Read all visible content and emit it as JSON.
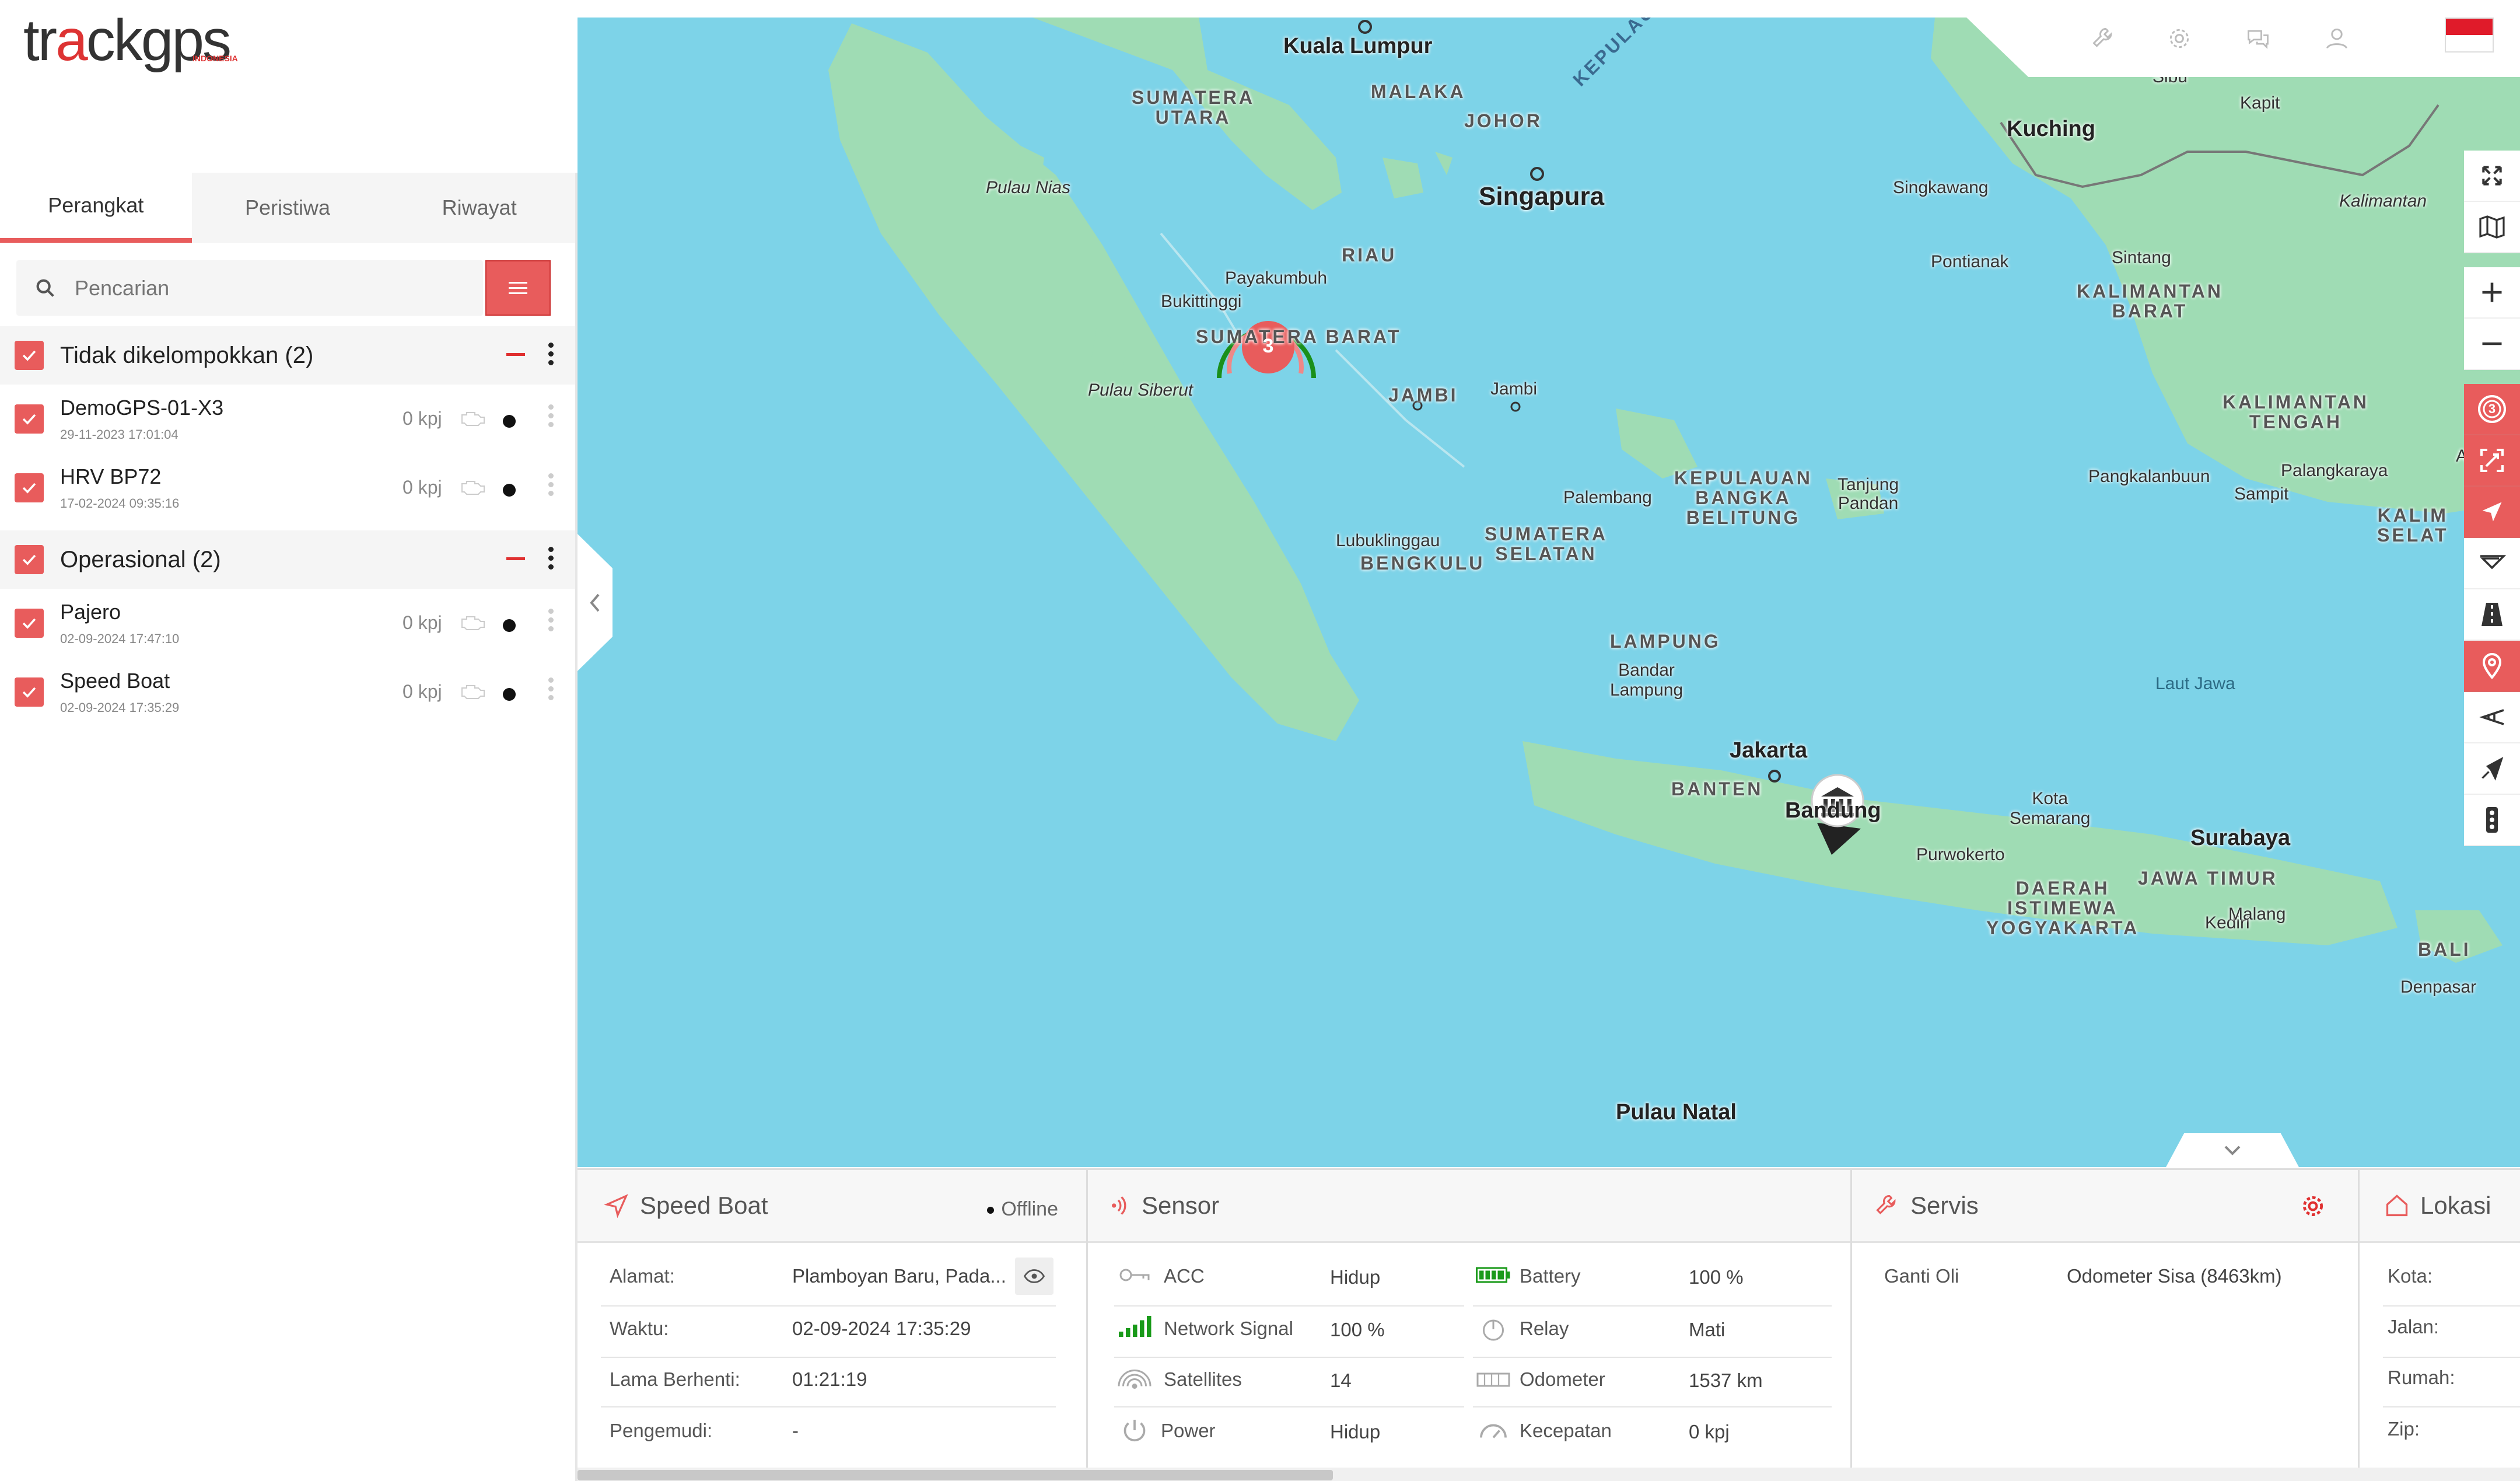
{
  "brand": {
    "logo_text_a": "tr",
    "logo_text_red": "a",
    "logo_text_b": "ckgps",
    "logo_sub": "INDONESIA"
  },
  "tabs": [
    {
      "label": "Perangkat",
      "active": true
    },
    {
      "label": "Peristiwa",
      "active": false
    },
    {
      "label": "Riwayat",
      "active": false
    }
  ],
  "search": {
    "placeholder": "Pencarian"
  },
  "groups": [
    {
      "label": "Tidak dikelompokkan (2)",
      "devices": [
        {
          "name": "DemoGPS-01-X3",
          "time": "29-11-2023 17:01:04",
          "speed": "0 kpj"
        },
        {
          "name": "HRV BP72",
          "time": "17-02-2024 09:35:16",
          "speed": "0 kpj"
        }
      ]
    },
    {
      "label": "Operasional (2)",
      "devices": [
        {
          "name": "Pajero",
          "time": "02-09-2024 17:47:10",
          "speed": "0 kpj"
        },
        {
          "name": "Speed Boat",
          "time": "02-09-2024 17:35:29",
          "speed": "0 kpj"
        }
      ]
    }
  ],
  "map": {
    "cluster_count": "3",
    "toolbar_badge": "3",
    "labels": {
      "kuala_lumpur": "Kuala Lumpur",
      "malaka": "MALAKA",
      "johor": "JOHOR",
      "singapura": "Singapura",
      "kepulauan_riau": "KEPULAUAN RIAU",
      "kuching": "Kuching",
      "sibu": "Sibu",
      "kapit": "Kapit",
      "sumatera_utara": "SUMATERA\nUTARA",
      "pulau_nias": "Pulau Nias",
      "riau": "RIAU",
      "payakumbuh": "Payakumbuh",
      "bukittinggi": "Bukittinggi",
      "sumatera_barat": "SUMATERA BARAT",
      "pulau_siberut": "Pulau Siberut",
      "jambi_prov": "JAMBI",
      "jambi_city": "Jambi",
      "singkawang": "Singkawang",
      "pontianak": "Pontianak",
      "sintang": "Sintang",
      "kalimantan_barat": "KALIMANTAN\nBARAT",
      "kalimantan_label": "Kalimantan",
      "kalimantan_tengah": "KALIMANTAN\nTENGAH",
      "palembang": "Palembang",
      "kep_bangka": "KEPULAUAN\nBANGKA\nBELITUNG",
      "tanjung_pandan": "Tanjung\nPandan",
      "pangkalanbuun": "Pangkalanbuun",
      "palangkaraya": "Palangkaraya",
      "sampit": "Sampit",
      "amuntai": "Amunt",
      "kalimantan_selatan": "KALIM\nSELAT",
      "lubuklinggau": "Lubuklinggau",
      "bengkulu": "BENGKULU",
      "sumatera_selatan": "SUMATERA\nSELATAN",
      "lampung": "LAMPUNG",
      "bandar_lampung": "Bandar\nLampung",
      "laut_jawa": "Laut Jawa",
      "jakarta": "Jakarta",
      "banten": "BANTEN",
      "bandung": "Bandung",
      "kota_semarang": "Kota\nSemarang",
      "surabaya": "Surabaya",
      "purwokerto": "Purwokerto",
      "jawa_timur": "JAWA TIMUR",
      "daerah_istimewa": "DAERAH\nISTIMEWA\nYOGYAKARTA",
      "kediri": "Kediri",
      "malang": "Malang",
      "bali": "BALI",
      "denpasar": "Denpasar",
      "pulau_natal": "Pulau Natal"
    }
  },
  "device_card": {
    "title": "Speed Boat",
    "status": "Offline",
    "rows": [
      {
        "label": "Alamat:",
        "value": "Plamboyan Baru, Pada..."
      },
      {
        "label": "Waktu:",
        "value": "02-09-2024 17:35:29"
      },
      {
        "label": "Lama Berhenti:",
        "value": "01:21:19"
      },
      {
        "label": "Pengemudi:",
        "value": "-"
      }
    ]
  },
  "sensor_card": {
    "title": "Sensor",
    "left": [
      {
        "label": "ACC",
        "value": "Hidup",
        "icon": "key-icon"
      },
      {
        "label": "Network Signal",
        "value": "100 %",
        "icon": "signal-bars-icon"
      },
      {
        "label": "Satellites",
        "value": "14",
        "icon": "satellite-icon"
      },
      {
        "label": "Power",
        "value": "Hidup",
        "icon": "power-icon"
      }
    ],
    "right": [
      {
        "label": "Battery",
        "value": "100 %",
        "icon": "battery-icon"
      },
      {
        "label": "Relay",
        "value": "Mati",
        "icon": "relay-icon"
      },
      {
        "label": "Odometer",
        "value": "1537 km",
        "icon": "odometer-icon"
      },
      {
        "label": "Kecepatan",
        "value": "0 kpj",
        "icon": "speedometer-icon"
      }
    ]
  },
  "service_card": {
    "title": "Servis",
    "item_label": "Ganti Oli",
    "item_value": "Odometer Sisa (8463km)"
  },
  "location_card": {
    "title": "Lokasi",
    "rows": [
      "Kota:",
      "Jalan:",
      "Rumah:",
      "Zip:"
    ]
  },
  "colors": {
    "accent": "#e85c5c",
    "sea": "#7dd3e8",
    "land": "#9fdcb4",
    "signal": "#1a9a1a"
  }
}
